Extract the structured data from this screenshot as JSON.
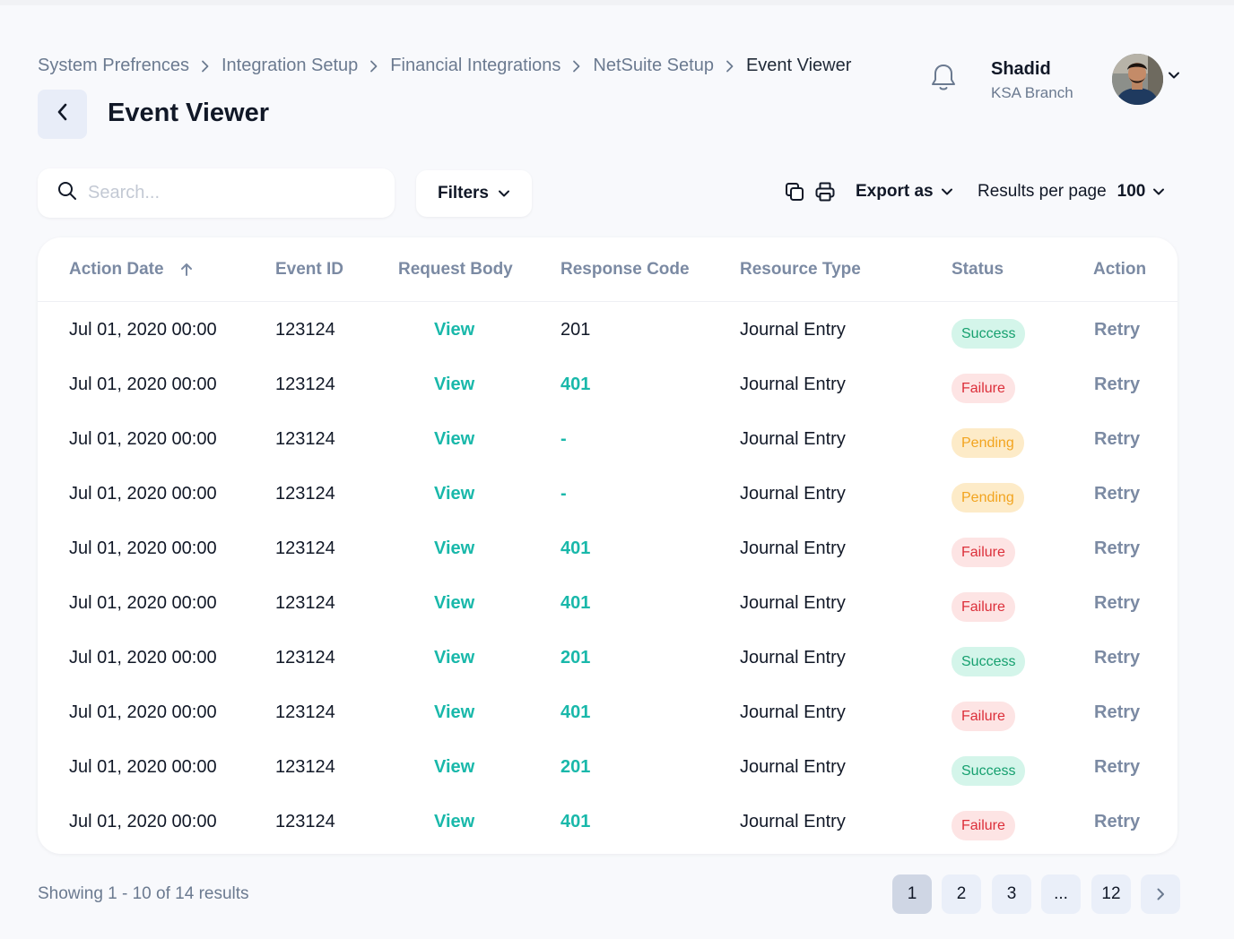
{
  "breadcrumb": {
    "items": [
      "System Prefrences",
      "Integration Setup",
      "Financial Integrations",
      "NetSuite Setup"
    ],
    "current": "Event Viewer"
  },
  "page": {
    "title": "Event Viewer"
  },
  "user": {
    "name": "Shadid",
    "branch": "KSA Branch"
  },
  "toolbar": {
    "search_placeholder": "Search...",
    "filters_label": "Filters",
    "export_label": "Export as",
    "results_per_page_label": "Results per page",
    "results_per_page_value": "100"
  },
  "table": {
    "headers": {
      "action_date": "Action Date",
      "event_id": "Event ID",
      "request_body": "Request Body",
      "response_code": "Response Code",
      "resource_type": "Resource Type",
      "status": "Status",
      "action": "Action"
    },
    "sort": {
      "column": "action_date",
      "direction": "ascending"
    },
    "rows": [
      {
        "date": "Jul 01, 2020 00:00",
        "event_id": "123124",
        "request": "View",
        "code": "201",
        "resource": "Journal Entry",
        "status": "Success",
        "action": "Retry"
      },
      {
        "date": "Jul 01, 2020 00:00",
        "event_id": "123124",
        "request": "View",
        "code": "401",
        "resource": "Journal Entry",
        "status": "Failure",
        "action": "Retry"
      },
      {
        "date": "Jul 01, 2020 00:00",
        "event_id": "123124",
        "request": "View",
        "code": "-",
        "resource": "Journal Entry",
        "status": "Pending",
        "action": "Retry"
      },
      {
        "date": "Jul 01, 2020 00:00",
        "event_id": "123124",
        "request": "View",
        "code": "-",
        "resource": "Journal Entry",
        "status": "Pending",
        "action": "Retry"
      },
      {
        "date": "Jul 01, 2020 00:00",
        "event_id": "123124",
        "request": "View",
        "code": "401",
        "resource": "Journal Entry",
        "status": "Failure",
        "action": "Retry"
      },
      {
        "date": "Jul 01, 2020 00:00",
        "event_id": "123124",
        "request": "View",
        "code": "401",
        "resource": "Journal Entry",
        "status": "Failure",
        "action": "Retry"
      },
      {
        "date": "Jul 01, 2020 00:00",
        "event_id": "123124",
        "request": "View",
        "code": "201",
        "resource": "Journal Entry",
        "status": "Success",
        "action": "Retry"
      },
      {
        "date": "Jul 01, 2020 00:00",
        "event_id": "123124",
        "request": "View",
        "code": "401",
        "resource": "Journal Entry",
        "status": "Failure",
        "action": "Retry"
      },
      {
        "date": "Jul 01, 2020 00:00",
        "event_id": "123124",
        "request": "View",
        "code": "201",
        "resource": "Journal Entry",
        "status": "Success",
        "action": "Retry"
      },
      {
        "date": "Jul 01, 2020 00:00",
        "event_id": "123124",
        "request": "View",
        "code": "401",
        "resource": "Journal Entry",
        "status": "Failure",
        "action": "Retry"
      }
    ]
  },
  "footer": {
    "showing": "Showing 1 - 10 of 14 results",
    "pages": [
      "1",
      "2",
      "3",
      "...",
      "12"
    ],
    "active_page": "1"
  },
  "colors": {
    "accent": "#19b8aa",
    "success_bg": "#d4f5ea",
    "success_text": "#16a06f",
    "failure_bg": "#fde4e4",
    "failure_text": "#dc2f3a",
    "pending_bg": "#fdebc8",
    "pending_text": "#f2a41f"
  },
  "icons": {
    "back": "chevron-left-icon",
    "bell": "bell-icon",
    "search": "search-icon",
    "copy": "copy-icon",
    "print": "printer-icon",
    "sort": "arrow-up-icon",
    "next": "chevron-right-icon"
  }
}
